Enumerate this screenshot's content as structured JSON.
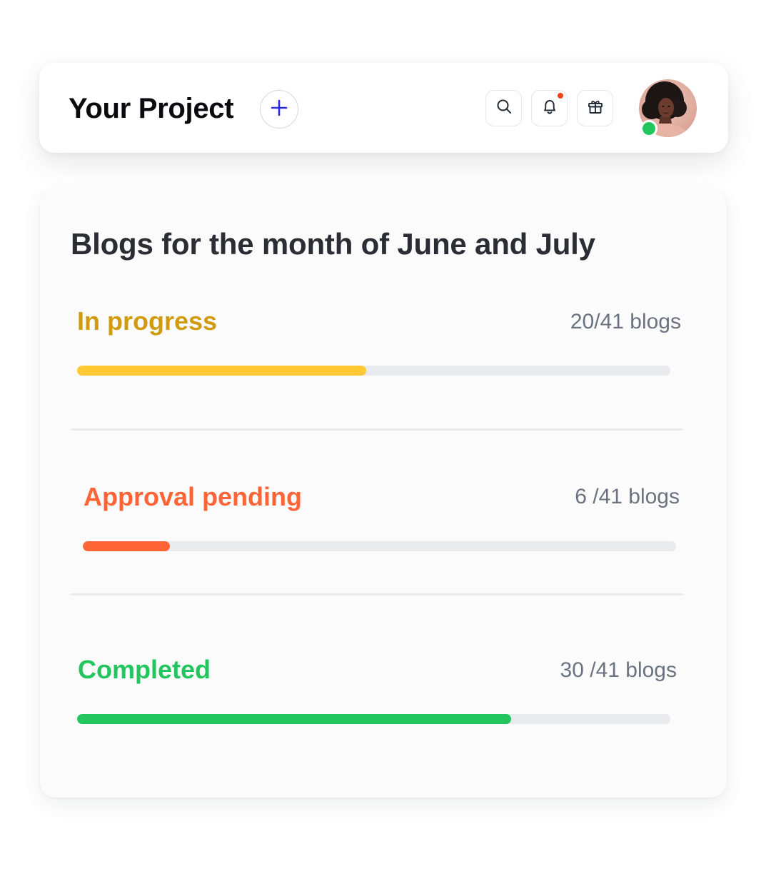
{
  "header": {
    "title": "Your Project",
    "add_icon": "plus-icon",
    "actions": [
      {
        "name": "search",
        "icon": "search-icon"
      },
      {
        "name": "notifications",
        "icon": "bell-icon",
        "has_unread": true
      },
      {
        "name": "gifts",
        "icon": "gift-icon"
      }
    ],
    "user": {
      "online": true
    }
  },
  "card": {
    "title": "Blogs for the month of June and July",
    "statuses": [
      {
        "label": "In progress",
        "count": "20/41 blogs",
        "completed": 20,
        "total": 41,
        "color": "#ffc933",
        "label_color": "#d19b0f"
      },
      {
        "label": "Approval pending",
        "count": "6 /41 blogs",
        "completed": 6,
        "total": 41,
        "color": "#ff6436",
        "label_color": "#ff6436"
      },
      {
        "label": "Completed",
        "count": "30 /41 blogs",
        "completed": 30,
        "total": 41,
        "color": "#22c55e",
        "label_color": "#22c55e"
      }
    ]
  },
  "colors": {
    "accent": "#2b2bd9",
    "online": "#22c55e",
    "notification": "#ef4416",
    "track": "#e8eaed"
  }
}
